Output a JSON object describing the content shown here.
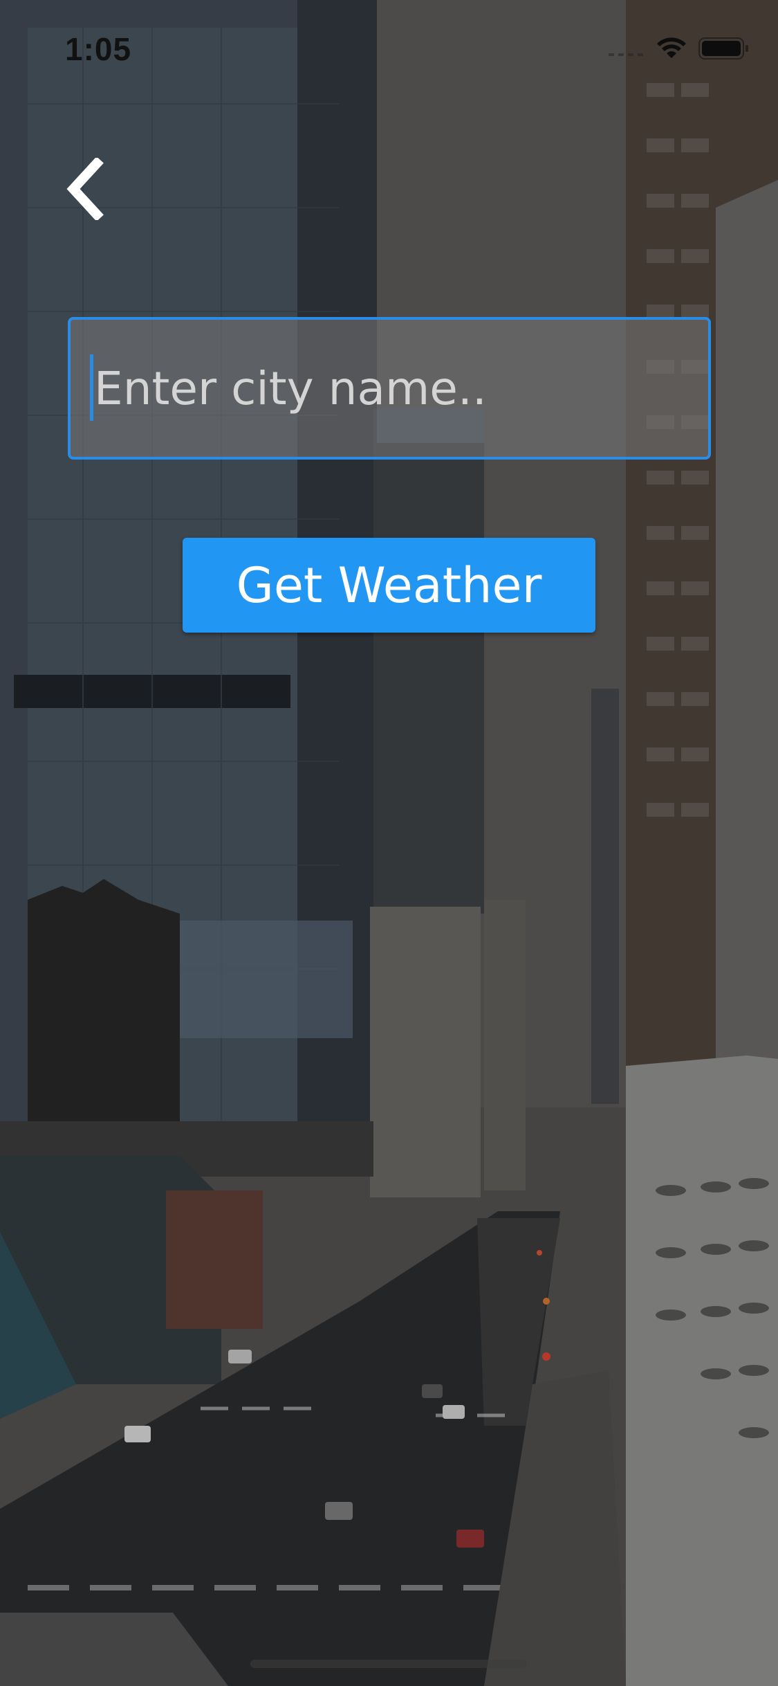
{
  "status_bar": {
    "time": "1:05"
  },
  "navigation": {
    "back_icon": "chevron-left-icon"
  },
  "search": {
    "placeholder": "Enter city name..",
    "value": ""
  },
  "actions": {
    "get_weather_label": "Get Weather"
  },
  "colors": {
    "accent": "#2196f3",
    "input_border": "#2b8ce5"
  }
}
